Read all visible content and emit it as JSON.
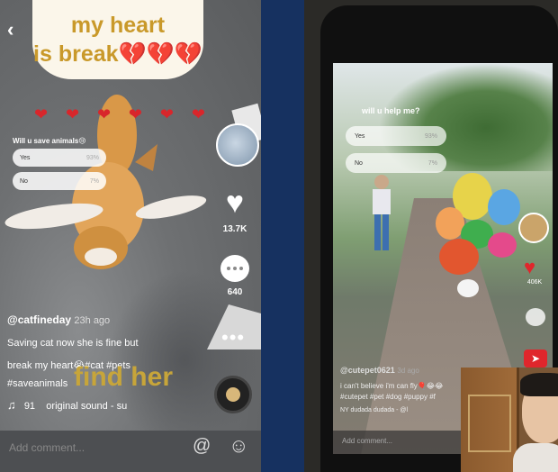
{
  "left": {
    "caption_line1": "my heart",
    "caption_line2": "is break💔💔💔",
    "poll": {
      "question": "Will u save animals😢",
      "options": [
        {
          "label": "Yes",
          "percent": "93%"
        },
        {
          "label": "No",
          "percent": "7%"
        }
      ]
    },
    "like_count": "13.7K",
    "comment_count": "640",
    "username": "@catfineday",
    "time": "23h ago",
    "description_line1": "Saving cat now she is fine but",
    "description_line2": "break my heart😭#cat #pets",
    "description_line3": "#saveanimals",
    "overlay_text": "find her",
    "music_count": "91",
    "music_title": "original sound - su",
    "comment_placeholder": "Add comment..."
  },
  "right": {
    "poll": {
      "question": "will u help me?",
      "options": [
        {
          "label": "Yes",
          "percent": "93%"
        },
        {
          "label": "No",
          "percent": "7%"
        }
      ]
    },
    "like_count": "406K",
    "username": "@cutepet0621",
    "time": "3d ago",
    "description_line1": "i can't believe i'm can fly🎈😂😂",
    "description_line2": "#cutepet #pet #dog #puppy #f",
    "music_text": "NY   dudada dudada - @l",
    "comment_placeholder": "Add comment..."
  }
}
